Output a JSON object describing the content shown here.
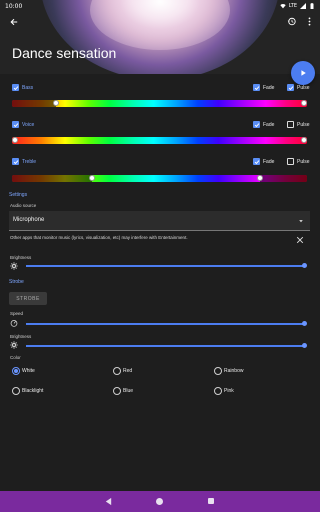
{
  "status": {
    "time": "10:00",
    "network": "LTE"
  },
  "header": {
    "title": "Dance sensation",
    "play_icon": "play-icon"
  },
  "bands": [
    {
      "label": "Bass",
      "enabled": true,
      "fade_label": "Fade",
      "fade": true,
      "pulse_label": "Pulse",
      "pulse": true,
      "range_low": 0.15,
      "range_high": 1.0
    },
    {
      "label": "Voice",
      "enabled": true,
      "fade_label": "Fade",
      "fade": true,
      "pulse_label": "Pulse",
      "pulse": false,
      "range_low": 0.0,
      "range_high": 1.0
    },
    {
      "label": "Treble",
      "enabled": true,
      "fade_label": "Fade",
      "fade": true,
      "pulse_label": "Pulse",
      "pulse": false,
      "range_low": 0.27,
      "range_high": 0.84
    }
  ],
  "settings": {
    "heading": "Settings",
    "audio_source_label": "Audio source",
    "audio_source_value": "Microphone",
    "info_text": "Other apps that monitor music (lyrics, visualization, etc) may interfere with Entertainment.",
    "brightness_label": "Brightness",
    "brightness_level": 1.0
  },
  "strobe": {
    "heading": "Strobe",
    "button_label": "STROBE",
    "speed_label": "Speed",
    "speed_level": 1.0,
    "brightness_label": "Brightness",
    "brightness_level": 1.0,
    "color_label": "Color",
    "colors": [
      {
        "label": "White",
        "selected": true
      },
      {
        "label": "Red",
        "selected": false
      },
      {
        "label": "Rainbow",
        "selected": false
      },
      {
        "label": "Blacklight",
        "selected": false
      },
      {
        "label": "Blue",
        "selected": false
      },
      {
        "label": "Pink",
        "selected": false
      }
    ]
  },
  "colors": {
    "accent": "#4c7df0",
    "navbar": "#7a2a9e",
    "background": "#1e1e1e"
  }
}
